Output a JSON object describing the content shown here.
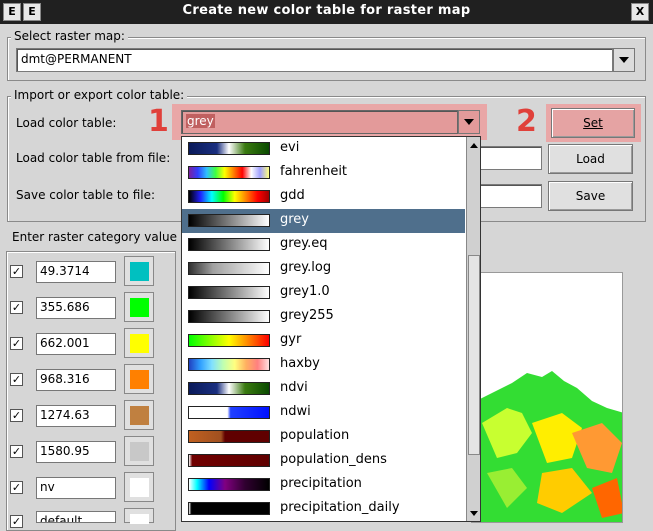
{
  "window": {
    "title": "Create new color table for raster map",
    "menu_btn": "E",
    "close_btn": "X"
  },
  "select_map": {
    "legend": "Select raster map:",
    "value": "dmt@PERMANENT"
  },
  "import_export": {
    "legend": "Import or export color table:",
    "load_label": "Load color table:",
    "load_value": "grey",
    "set_label": "Set",
    "file_label": "Load color table from file:",
    "load_btn": "Load",
    "save_label": "Save color table to file:",
    "save_btn": "Save"
  },
  "annotations": {
    "one": "1",
    "two": "2"
  },
  "category": {
    "legend": "Enter raster category value",
    "rows": [
      {
        "value": "49.3714",
        "color": "#00c0c0",
        "check": "✓"
      },
      {
        "value": "355.686",
        "color": "#00ff00",
        "check": "✓"
      },
      {
        "value": "662.001",
        "color": "#ffff00",
        "check": "✓"
      },
      {
        "value": "968.316",
        "color": "#ff8000",
        "check": "✓"
      },
      {
        "value": "1274.63",
        "color": "#c08040",
        "check": "✓"
      },
      {
        "value": "1580.95",
        "color": "#c8c8c8",
        "check": "✓"
      },
      {
        "value": "nv",
        "color": "#ffffff",
        "check": "✓"
      },
      {
        "value": "default",
        "color": "#ffffff",
        "check": "✓"
      }
    ]
  },
  "dropdown": {
    "items": [
      {
        "label": "evi",
        "gradient": "linear-gradient(90deg,#0a1a5a 0%,#1a2f80 35%,#ffffff 50%,#3a7a10 70%,#0a4a00 100%)"
      },
      {
        "label": "fahrenheit",
        "gradient": "linear-gradient(90deg,#7a20a0,#3040ff,#30c0ff,#40ff40,#ffff00,#ff8000,#ff0000,#ffffff,#a0a0ff,#ffff80)"
      },
      {
        "label": "gdd",
        "gradient": "linear-gradient(90deg,#000000,#2020ff,#00ffff,#00ff00,#ffff00,#ff8000,#ff0000,#a00000)"
      },
      {
        "label": "grey",
        "gradient": "linear-gradient(90deg,#000000,#ffffff)"
      },
      {
        "label": "grey.eq",
        "gradient": "linear-gradient(90deg,#000000,#ffffff)"
      },
      {
        "label": "grey.log",
        "gradient": "linear-gradient(90deg,#303030,#a0a0a0 30%,#ffffff)"
      },
      {
        "label": "grey1.0",
        "gradient": "linear-gradient(90deg,#000000,#ffffff)"
      },
      {
        "label": "grey255",
        "gradient": "linear-gradient(90deg,#000000,#ffffff)"
      },
      {
        "label": "gyr",
        "gradient": "linear-gradient(90deg,#00ff00,#ffff00,#ff0000)"
      },
      {
        "label": "haxby",
        "gradient": "linear-gradient(90deg,#2040c0,#30a0ff,#80e0ff,#c0ffb0,#ffff80,#ffb060,#ff8080,#ffe0e0)"
      },
      {
        "label": "ndvi",
        "gradient": "linear-gradient(90deg,#0a1a5a 0%,#1a2f80 35%,#ffffff 50%,#3a7a10 70%,#0a4a00 100%)"
      },
      {
        "label": "ndwi",
        "gradient": "linear-gradient(90deg,#ffffff 0%,#ffffff 48%,#2040ff 52%,#0010ff 100%)"
      },
      {
        "label": "population",
        "gradient": "linear-gradient(90deg,#c06020 0%,#a05020 40%,#600000 45%,#600000 100%)"
      },
      {
        "label": "population_dens",
        "gradient": "linear-gradient(90deg,#ffffff 0%,#700000 4%,#600000 100%)"
      },
      {
        "label": "precipitation",
        "gradient": "linear-gradient(90deg,#ffffff,#00ffff 10%,#0000ff 25%,#800080 45%,#300030 70%,#000000)"
      },
      {
        "label": "precipitation_daily",
        "gradient": "linear-gradient(90deg,#ffffff 0%,#000000 3%,#000000 100%)"
      }
    ],
    "selected": "grey"
  }
}
